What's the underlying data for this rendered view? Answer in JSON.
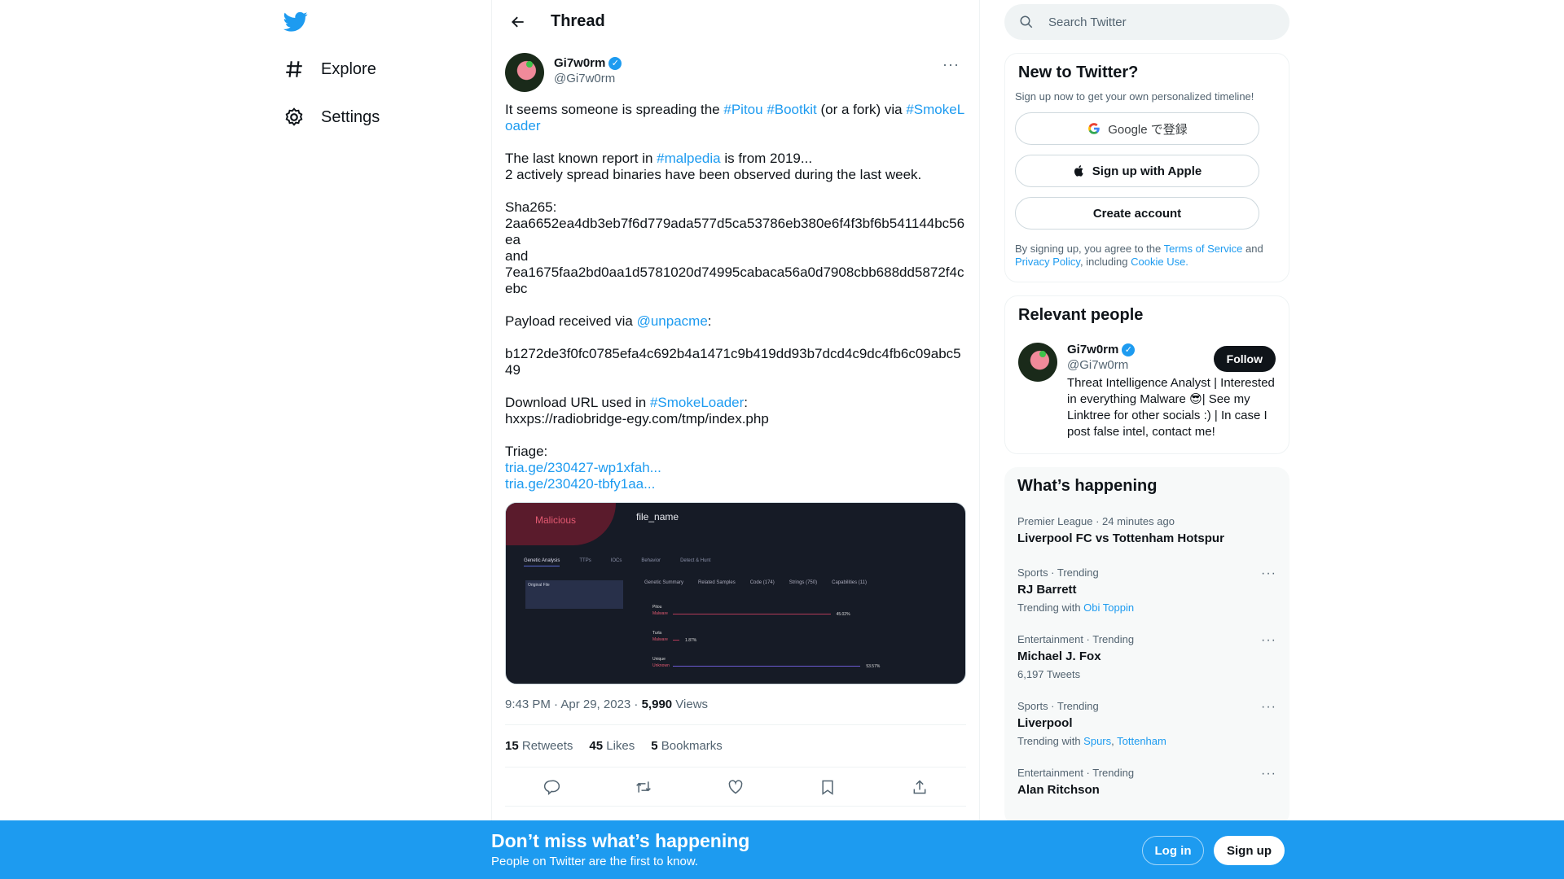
{
  "colors": {
    "accent": "#1d9bf0",
    "text": "#0f1419",
    "muted": "#536471"
  },
  "nav": {
    "logo": "twitter-bird-icon",
    "items": [
      {
        "label": "Explore",
        "icon": "hashtag-icon"
      },
      {
        "label": "Settings",
        "icon": "gear-icon"
      }
    ]
  },
  "header": {
    "title": "Thread"
  },
  "tweet": {
    "name": "Gi7w0rm",
    "handle": "@Gi7w0rm",
    "p1": {
      "a": "It seems someone is spreading the ",
      "t1": "#Pitou",
      "t2": "#Bootkit",
      "b": " (or a fork) via ",
      "t3": "#SmokeLoader"
    },
    "p2": {
      "a": "The last known report in ",
      "t1": "#malpedia",
      "b": " is from 2019...",
      "c": "2 actively spread binaries have been observed during the last week."
    },
    "p3": {
      "a": "Sha265:",
      "h1": "2aa6652ea4db3eb7f6d779ada577d5ca53786eb380e6f4f3bf6b541144bc56ea",
      "and": "and",
      "h2": "7ea1675faa2bd0aa1d5781020d74995cabaca56a0d7908cbb688dd5872f4cebc"
    },
    "p4": {
      "a": "Payload received via ",
      "m": "@unpacme",
      "b": ":"
    },
    "p5": "b1272de3f0fc0785efa4c692b4a1471c9b419dd93b7dcd4c9dc4fb6c09abc549",
    "p6": {
      "a": "Download URL used in ",
      "t": "#SmokeLoader",
      "b": ":",
      "url": "hxxps://radiobridge-egy.com/tmp/index.php"
    },
    "p7": {
      "a": "Triage:",
      "l1": "tria.ge/230427-wp1xfah...",
      "l2": "tria.ge/230420-tbfy1aa..."
    },
    "media": {
      "verdict": "Malicious",
      "file": "file_name",
      "tabs": [
        "Genetic Analysis",
        "TTPs",
        "IOCs",
        "Behavior",
        "Detect & Hunt"
      ],
      "subtabs": [
        "Genetic Summary",
        "Related Samples",
        "Code (174)",
        "Strings (750)",
        "Capabilities (11)"
      ],
      "original_file": "Original File",
      "families": [
        {
          "name": "Pitou",
          "type": "Malware",
          "pct": "45.02%",
          "value": 45.02
        },
        {
          "name": "Turla",
          "type": "Malware",
          "pct": "1.87%",
          "value": 1.87
        },
        {
          "name": "Unique",
          "type": "Unknown",
          "pct": "53.57%",
          "value": 53.57
        }
      ]
    },
    "time": "9:43 PM · Apr 29, 2023 · ",
    "views_count": "5,990",
    "views_label": " Views",
    "stats": [
      {
        "n": "15",
        "l": " Retweets"
      },
      {
        "n": "45",
        "l": " Likes"
      },
      {
        "n": "5",
        "l": " Bookmarks"
      }
    ]
  },
  "search": {
    "placeholder": "Search Twitter"
  },
  "signup": {
    "title": "New to Twitter?",
    "sub": "Sign up now to get your own personalized timeline!",
    "google": "Google で登録",
    "apple": "Sign up with Apple",
    "create": "Create account",
    "legal_a": "By signing up, you agree to the ",
    "tos": "Terms of Service",
    "legal_b": " and ",
    "privacy": "Privacy Policy",
    "legal_c": ", including ",
    "cookie": "Cookie Use."
  },
  "relevant": {
    "title": "Relevant people",
    "name": "Gi7w0rm",
    "handle": "@Gi7w0rm",
    "follow": "Follow",
    "bio": "Threat Intelligence Analyst | Interested in everything Malware 😎| See my Linktree for other socials :) | In case I post false intel, contact me!"
  },
  "trends": {
    "title": "What’s happening",
    "items": [
      {
        "cat": "Premier League · 24 minutes ago",
        "title": "Liverpool FC vs Tottenham Hotspur"
      },
      {
        "cat": "Sports · Trending",
        "title": "RJ Barrett",
        "ex": "Trending with ",
        "links": [
          "Obi Toppin"
        ]
      },
      {
        "cat": "Entertainment · Trending",
        "title": "Michael J. Fox",
        "ex": "6,197 Tweets"
      },
      {
        "cat": "Sports · Trending",
        "title": "Liverpool",
        "ex": "Trending with ",
        "links": [
          "Spurs",
          "Tottenham"
        ]
      },
      {
        "cat": "Entertainment · Trending",
        "title": "Alan Ritchson"
      }
    ]
  },
  "bottom": {
    "title": "Don’t miss what’s happening",
    "sub": "People on Twitter are the first to know.",
    "login": "Log in",
    "signup": "Sign up"
  }
}
